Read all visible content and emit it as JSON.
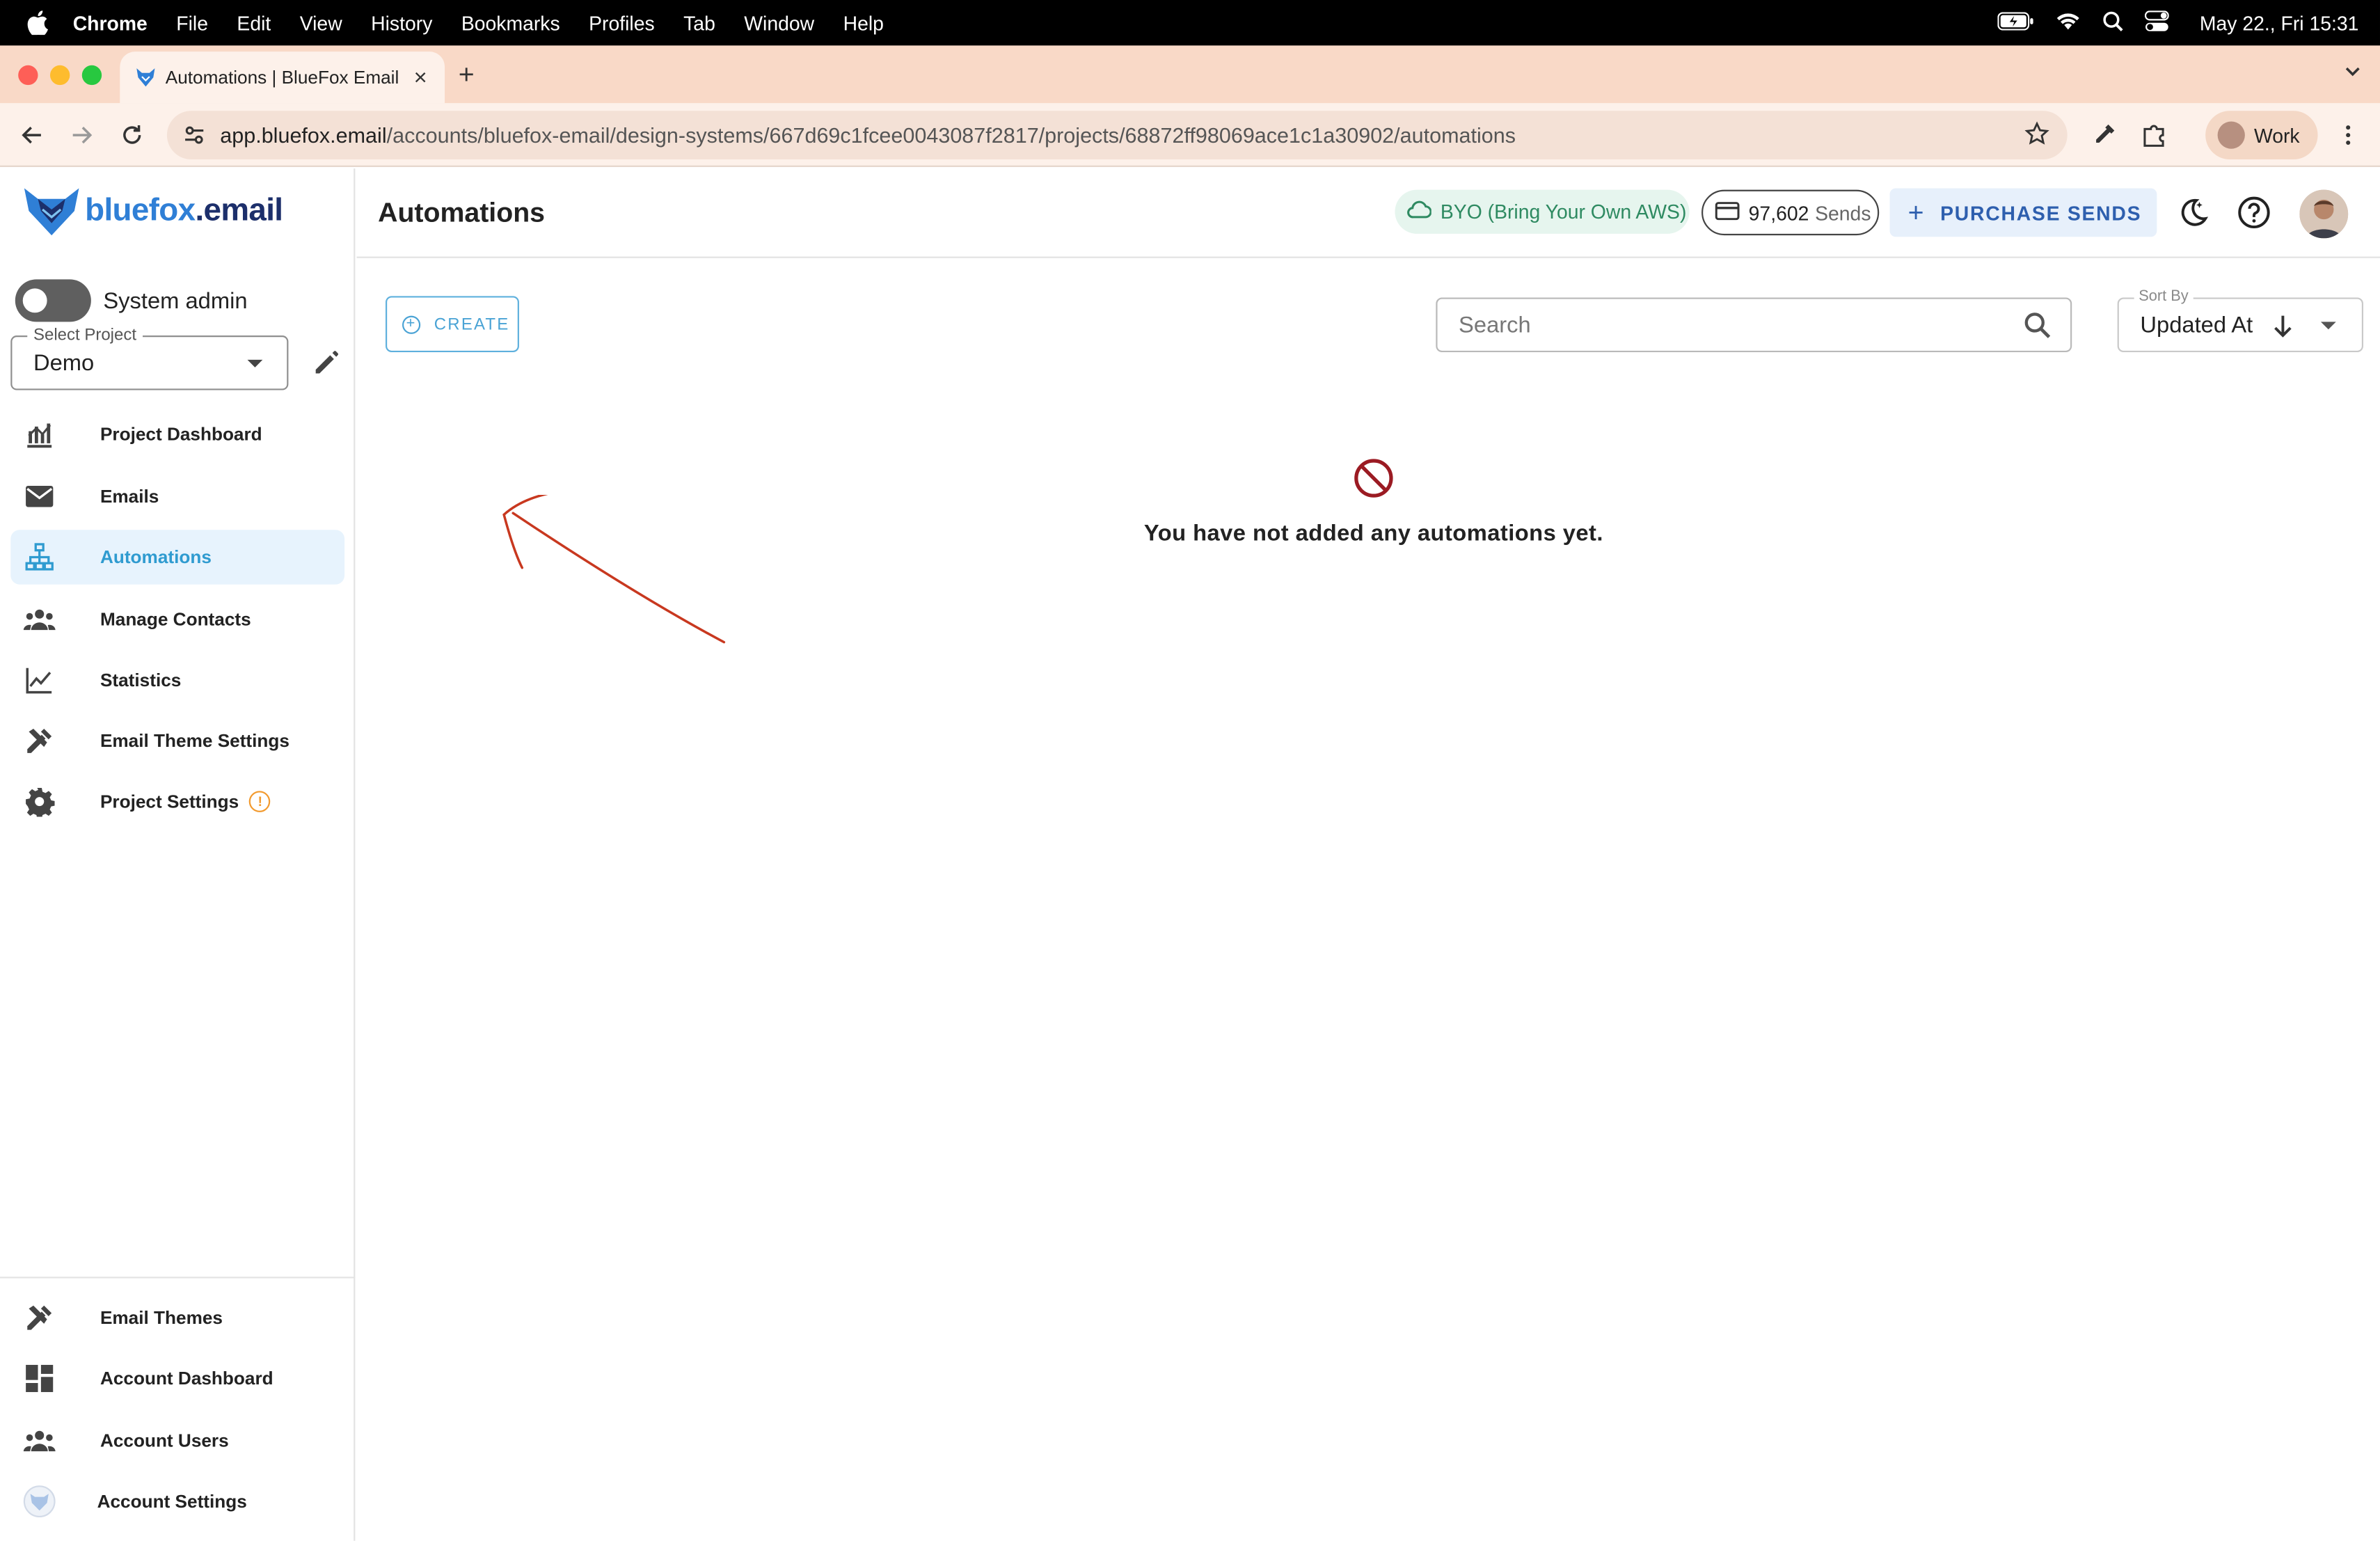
{
  "menubar": {
    "app": "Chrome",
    "items": [
      "File",
      "Edit",
      "View",
      "History",
      "Bookmarks",
      "Profiles",
      "Tab",
      "Window",
      "Help"
    ],
    "clock": "May 22., Fri  15:31"
  },
  "browser": {
    "tab_title": "Automations | BlueFox Email",
    "url_host": "app.bluefox.email",
    "url_path": "/accounts/bluefox-email/design-systems/667d69c1fcee0043087f2817/projects/68872ff98069ace1c1a30902/automations",
    "profile_label": "Work"
  },
  "logo": {
    "brand": "bluefox",
    "tld": ".email"
  },
  "sidebar": {
    "system_admin_label": "System admin",
    "project_select_label": "Select Project",
    "project_value": "Demo",
    "nav": [
      {
        "label": "Project Dashboard",
        "icon": "dashboard-chart-icon"
      },
      {
        "label": "Emails",
        "icon": "mail-icon"
      },
      {
        "label": "Automations",
        "icon": "sitemap-icon",
        "active": true
      },
      {
        "label": "Manage Contacts",
        "icon": "people-icon"
      },
      {
        "label": "Statistics",
        "icon": "line-chart-icon"
      },
      {
        "label": "Email Theme Settings",
        "icon": "design-tools-icon"
      },
      {
        "label": "Project Settings",
        "icon": "gear-icon",
        "warning": "!"
      }
    ],
    "bottom_nav": [
      {
        "label": "Email Themes",
        "icon": "design-tools-icon"
      },
      {
        "label": "Account Dashboard",
        "icon": "grid-dashboard-icon"
      },
      {
        "label": "Account Users",
        "icon": "people-icon"
      },
      {
        "label": "Account Settings",
        "icon": "fox-logo-icon"
      }
    ]
  },
  "topbar": {
    "title": "Automations",
    "byo_label": "BYO (Bring Your Own AWS)",
    "sends_count": "97,602",
    "sends_label": "Sends",
    "purchase_label": "PURCHASE SENDS"
  },
  "content": {
    "create_label": "CREATE",
    "search_placeholder": "Search",
    "sort_legend": "Sort By",
    "sort_value": "Updated At",
    "empty_message": "You have not added any automations yet."
  },
  "colors": {
    "accent": "#2f9bd0",
    "tab_strip": "#f9d9c7",
    "byo_green": "#2e8a61",
    "purchase_blue": "#2e5fae",
    "annotation_red": "#c8381f",
    "empty_icon": "#9b1b23"
  }
}
